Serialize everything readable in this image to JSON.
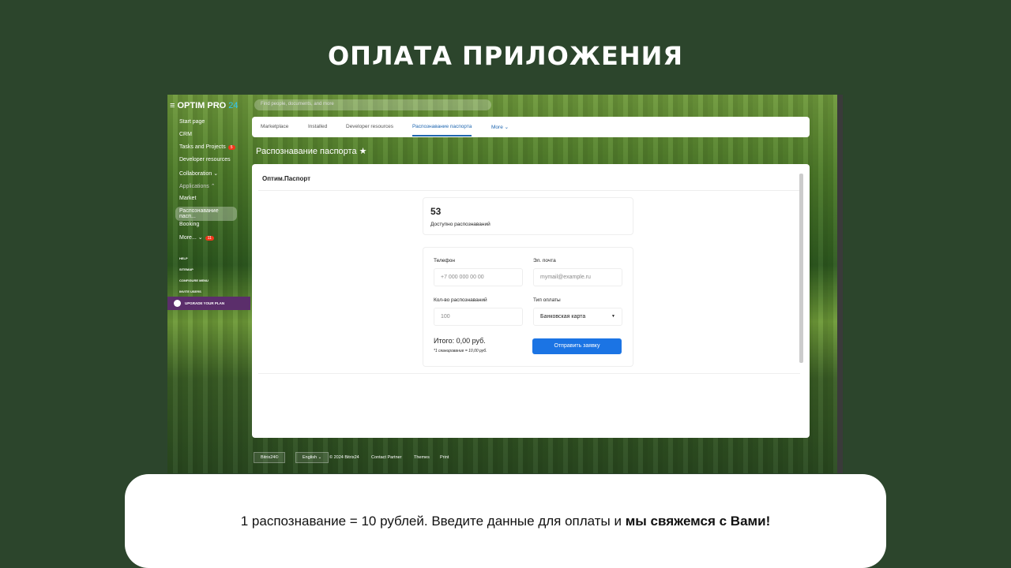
{
  "title": "ОПЛАТА ПРИЛОЖЕНИЯ",
  "app": {
    "logo": "OPTIM PRO",
    "logo_suffix": "24",
    "search_placeholder": "Find people, documents, and more"
  },
  "sidebar": {
    "items": [
      {
        "label": "Start page"
      },
      {
        "label": "CRM"
      },
      {
        "label": "Tasks and Projects",
        "badge": "5"
      },
      {
        "label": "Developer resources"
      },
      {
        "label": "Collaboration ⌄"
      },
      {
        "label": "Applications ⌃"
      },
      {
        "label": "Market"
      },
      {
        "label": "Распознавание пасп..."
      },
      {
        "label": "Booking"
      },
      {
        "label": "More... ⌄",
        "badge": "11"
      }
    ],
    "small": [
      "HELP",
      "SITEMAP",
      "CONFIGURE MENU",
      "INVITE USERS"
    ],
    "upgrade": "UPGRADE YOUR PLAN"
  },
  "tabs": [
    "Marketplace",
    "Installed",
    "Developer resources",
    "Распознавание паспорта",
    "More ⌄"
  ],
  "page_title": "Распознавание паспорта ★",
  "card": {
    "title": "Оптим.Паспорт",
    "count": "53",
    "count_label": "Доступно распознаваний",
    "phone_label": "Телефон",
    "phone_placeholder": "+7 000 000 00 00",
    "email_label": "Эл. почта",
    "email_placeholder": "mymail@example.ru",
    "qty_label": "Кол-во распознаваний",
    "qty_value": "100",
    "pay_label": "Тип оплаты",
    "pay_value": "Банковская карта",
    "total": "Итого: 0,00 руб.",
    "note": "*1 сканирование = 10,00 руб.",
    "submit": "Отправить заявку"
  },
  "footer": [
    "Bitrix24©",
    "English ⌄",
    "© 2024 Bitrix24",
    "Contact Partner",
    "Themes",
    "Print"
  ],
  "caption": {
    "text": "1 распознавание = 10 рублей. Введите данные для оплаты и ",
    "bold": "мы свяжемся с Вами!"
  }
}
